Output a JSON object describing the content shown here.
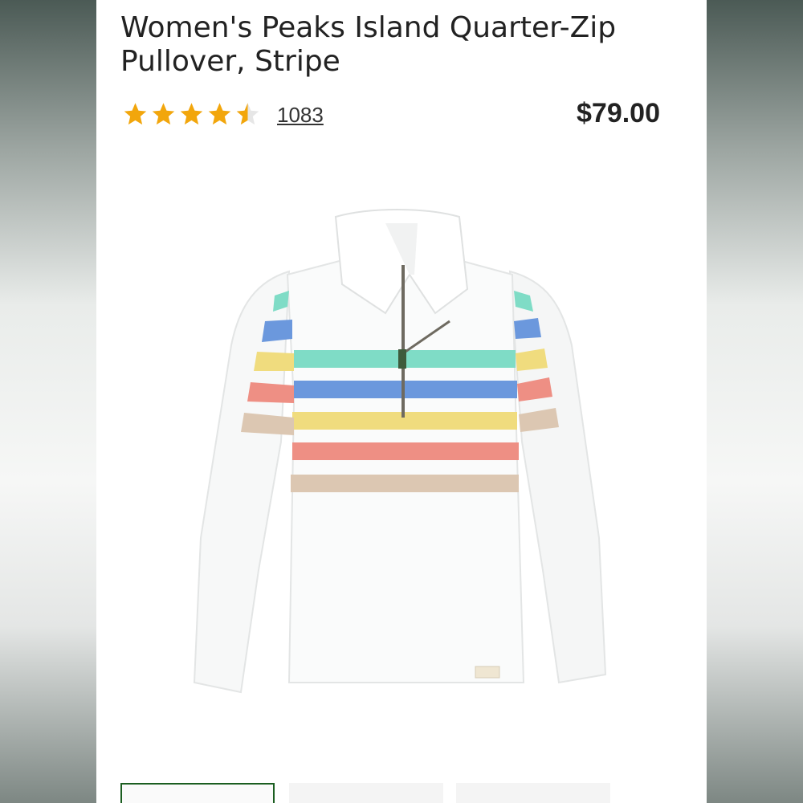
{
  "product": {
    "title": "Women's Peaks Island Quarter-Zip Pullover, Stripe",
    "rating": 4.5,
    "rating_max": 5,
    "review_count": "1083",
    "price": "$79.00"
  },
  "icons": {
    "star": "star-icon",
    "star_half": "half-star-icon"
  },
  "colors": {
    "star": "#f2a60c",
    "active_thumb_border": "#1b5e20",
    "stripe_mint": "#7fdcc6",
    "stripe_blue": "#6b98dd",
    "stripe_yellow": "#f0dc7e",
    "stripe_coral": "#ee8f84",
    "stripe_tan": "#dcc7b2"
  }
}
